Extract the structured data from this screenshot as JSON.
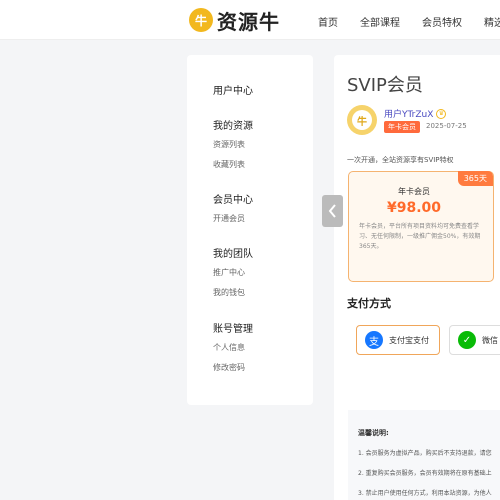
{
  "header": {
    "logo_badge": "牛",
    "logo_text": "资源牛",
    "nav": [
      "首页",
      "全部课程",
      "会员特权",
      "精选文"
    ]
  },
  "sidebar": {
    "groups": [
      {
        "title": "用户中心",
        "items": []
      },
      {
        "title": "我的资源",
        "items": [
          "资源列表",
          "收藏列表"
        ]
      },
      {
        "title": "会员中心",
        "items": [
          "开通会员"
        ]
      },
      {
        "title": "我的团队",
        "items": [
          "推广中心",
          "我的钱包"
        ]
      },
      {
        "title": "账号管理",
        "items": [
          "个人信息",
          "修改密码"
        ]
      }
    ]
  },
  "main": {
    "title": "SVIP会员",
    "username": "用户YTrZuX",
    "user_tag": "年卡会员",
    "date": "2025-07-25",
    "description": "一次开通，全站资源享有SVIP特权",
    "plan": {
      "badge": "365天",
      "name": "年卡会员",
      "price": "¥98.00",
      "desc": "年卡会员，平台所有项目资料均可免费查看学习、无任何限制，一级推广佣金50%，有效期365天。"
    },
    "payment": {
      "title": "支付方式",
      "alipay_label": "支付宝支付",
      "wechat_label": "微信"
    },
    "notice": {
      "title": "温馨说明:",
      "lines": [
        "1. 会员服务为虚拟产品，购买后不支持退款，请您",
        "2. 重复购买会员服务，会员有效期将在原有基础上",
        "3. 禁止用户使用任何方式，利用本站资源，为他人"
      ]
    }
  },
  "colors": {
    "brand": "#f2b81e",
    "accent": "#ff6a2a",
    "alipay": "#1677ff",
    "wechat": "#09bb07"
  }
}
